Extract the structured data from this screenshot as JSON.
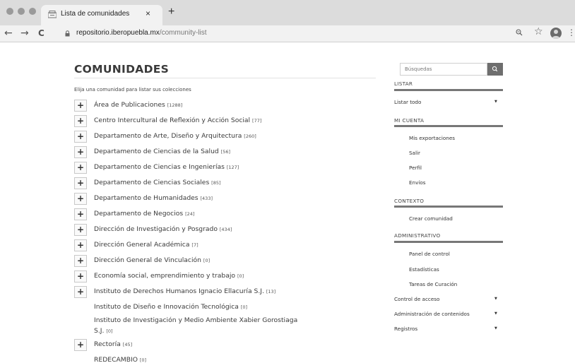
{
  "browser": {
    "tab_title": "Lista de comunidades",
    "tab_close": "×",
    "new_tab": "+",
    "url_host": "repositorio.iberopuebla.mx",
    "url_path": "/community-list",
    "back": "←",
    "forward": "→",
    "reload": "C",
    "star": "☆",
    "menu": "⋮"
  },
  "page": {
    "title": "COMUNIDADES",
    "subtitle": "Elija una comunidad para listar sus colecciones",
    "communities": [
      {
        "name": "Área de Publicaciones",
        "count": "[1288]",
        "expandable": true
      },
      {
        "name": "Centro Intercultural de Reflexión y Acción Social",
        "count": "[77]",
        "expandable": true
      },
      {
        "name": "Departamento de Arte, Diseño y Arquitectura",
        "count": "[260]",
        "expandable": true
      },
      {
        "name": "Departamento de Ciencias de la Salud",
        "count": "[56]",
        "expandable": true
      },
      {
        "name": "Departamento de Ciencias e Ingenierías",
        "count": "[127]",
        "expandable": true
      },
      {
        "name": "Departamento de Ciencias Sociales",
        "count": "[85]",
        "expandable": true
      },
      {
        "name": "Departamento de Humanidades",
        "count": "[433]",
        "expandable": true
      },
      {
        "name": "Departamento de Negocios",
        "count": "[24]",
        "expandable": true
      },
      {
        "name": "Dirección de Investigación y Posgrado",
        "count": "[434]",
        "expandable": true
      },
      {
        "name": "Dirección General Académica",
        "count": "[7]",
        "expandable": true
      },
      {
        "name": "Dirección General de Vinculación",
        "count": "[0]",
        "expandable": true
      },
      {
        "name": "Economía social, emprendimiento y trabajo",
        "count": "[0]",
        "expandable": true
      },
      {
        "name": "Instituto de Derechos Humanos Ignacio Ellacuría S.J.",
        "count": "[13]",
        "expandable": true
      },
      {
        "name": "Instituto de Diseño e Innovación Tecnológica",
        "count": "[0]",
        "expandable": false
      },
      {
        "name": "Instituto de Investigación y Medio Ambiente Xabier Gorostiaga",
        "name_line2": "S.J.",
        "count": "[0]",
        "expandable": false
      },
      {
        "name": "Rectoría",
        "count": "[45]",
        "expandable": true
      },
      {
        "name": "REDECAMBIO",
        "count": "[0]",
        "expandable": false
      }
    ],
    "plus": "+"
  },
  "sidebar": {
    "search_placeholder": "Búsquedas",
    "listar": {
      "heading": "LISTAR",
      "item": "Listar todo",
      "caret": "▼"
    },
    "mi_cuenta": {
      "heading": "MI CUENTA",
      "items": [
        "Mis exportaciones",
        "Salir",
        "Perfil",
        "Envíos"
      ]
    },
    "contexto": {
      "heading": "CONTEXTO",
      "items": [
        "Crear comunidad"
      ]
    },
    "administrativo": {
      "heading": "ADMINISTRATIVO",
      "items": [
        "Panel de control",
        "Estadísticas",
        "Tareas de Curación"
      ],
      "menus": [
        "Control de acceso",
        "Administración de contenidos",
        "Registros"
      ],
      "caret": "▼"
    }
  },
  "colors": {
    "chrome": "#dcdcdc",
    "sidebar_rule": "#777777",
    "search_button": "#6e6e6e"
  }
}
